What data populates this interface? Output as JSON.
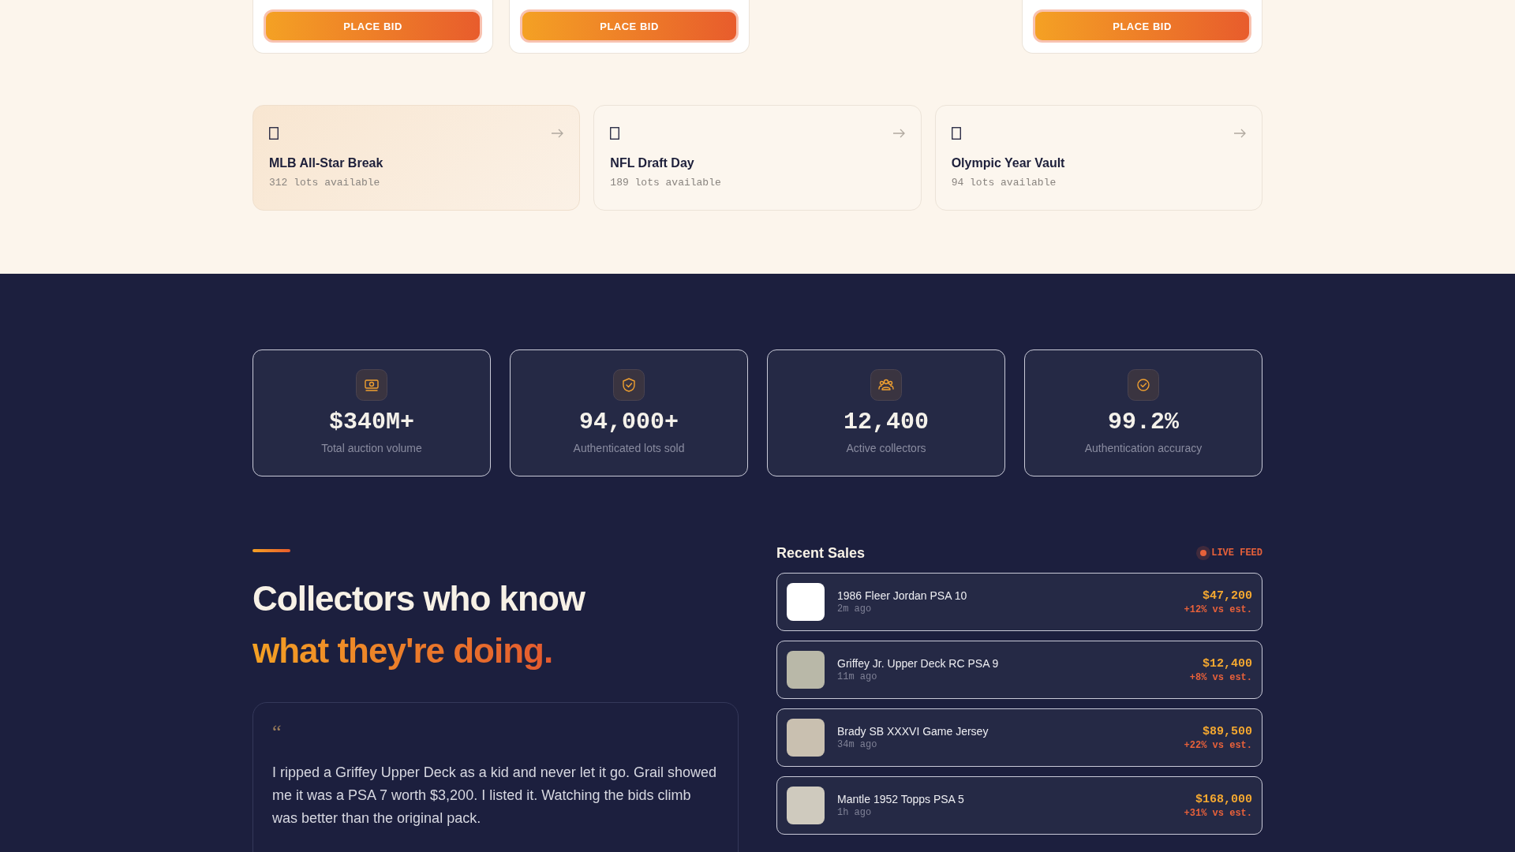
{
  "bid_cards": [
    {
      "kind": "card",
      "button": "PLACE BID"
    },
    {
      "kind": "card",
      "button": "PLACE BID"
    },
    {
      "kind": "empty"
    },
    {
      "kind": "card",
      "button": "PLACE BID"
    }
  ],
  "categories": [
    {
      "title": "MLB All-Star Break",
      "count": "312 lots available",
      "selected": true
    },
    {
      "title": "NFL Draft Day",
      "count": "189 lots available",
      "selected": false
    },
    {
      "title": "Olympic Year Vault",
      "count": "94 lots available",
      "selected": false
    }
  ],
  "stats": [
    {
      "kind": "money",
      "value": "$340M+",
      "label": "Total auction volume"
    },
    {
      "kind": "shield",
      "value": "94,000+",
      "label": "Authenticated lots sold"
    },
    {
      "kind": "people",
      "value": "12,400",
      "label": "Active collectors"
    },
    {
      "kind": "check",
      "value": "99.2%",
      "label": "Authentication accuracy"
    }
  ],
  "heading": {
    "line1": "Collectors who know",
    "line2": "what they're doing."
  },
  "testimonial": {
    "mark": "“",
    "text": "I ripped a Griffey Upper Deck as a kid and never let it go. Grail showed me it was a PSA 7 worth $3,200. I listed it. Watching the bids climb was better than the original pack."
  },
  "recent_sales": {
    "title": "Recent Sales",
    "badge": "LIVE FEED",
    "items": [
      {
        "name": "1986 Fleer Jordan PSA 10",
        "time": "2m ago",
        "price": "$47,200",
        "delta": "+12% vs est."
      },
      {
        "name": "Griffey Jr. Upper Deck RC PSA 9",
        "time": "11m ago",
        "price": "$12,400",
        "delta": "+8% vs est."
      },
      {
        "name": "Brady SB XXXVI Game Jersey",
        "time": "34m ago",
        "price": "$89,500",
        "delta": "+22% vs est."
      },
      {
        "name": "Mantle 1952 Topps PSA 5",
        "time": "1h ago",
        "price": "$168,000",
        "delta": "+31% vs est."
      }
    ]
  }
}
